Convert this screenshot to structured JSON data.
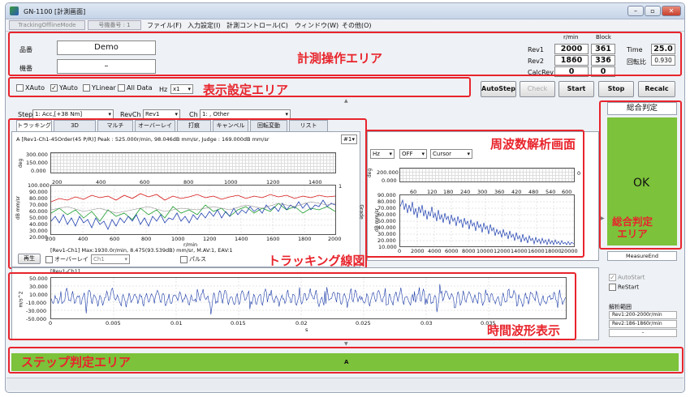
{
  "window": {
    "title": "GN-1100 [計測画面]"
  },
  "menubar": {
    "mode": "TrackingOfflineMode",
    "machine": "号機番号 : 1",
    "items": [
      "ファイル(F)",
      "入力設定(I)",
      "計測コントロール(C)",
      "ウィンドウ(W)",
      "その他(O)"
    ]
  },
  "measure": {
    "product_label": "品番",
    "product_value": "Demo",
    "model_label": "機番",
    "model_value": "–",
    "col_rpm": "r/min",
    "col_block": "Block",
    "rev1_label": "Rev1",
    "rev1_rpm": "2000",
    "rev1_block": "361",
    "rev2_label": "Rev2",
    "rev2_rpm": "1860",
    "rev2_block": "336",
    "calcrev_label": "CalcRev",
    "calcrev_rpm": "0",
    "calcrev_block": "0",
    "time_label": "Time",
    "time_value": "25.0",
    "ratio_label": "回転比",
    "ratio_value": "0.930"
  },
  "display": {
    "xauto": "XAuto",
    "yauto": "YAuto",
    "ylinear": "YLinear",
    "alldata": "All Data",
    "hz_label": "Hz",
    "hz_value": "x1"
  },
  "buttons": {
    "autostep": "AutoStep",
    "check": "Check",
    "start": "Start",
    "stop": "Stop",
    "recalc": "Recalc"
  },
  "selectors": {
    "step_label": "Step",
    "step_value": "1: Acc,[+38 Nm]",
    "revch_label": "RevCh",
    "revch_value": "Rev1",
    "ch_label": "Ch",
    "ch_value": "1: , Other"
  },
  "tabs": [
    "トラッキング",
    "3D",
    "マルチ",
    "オーバーレイ",
    "打痕",
    "キャンベル",
    "回転変動",
    "リスト"
  ],
  "tracking": {
    "header": "A [Rev1-Ch1-45Order(45 P/R)] Peak : 525.000r/min, 98.046dB mm/sr, Judge : 169.000dB mm/sr",
    "selector": "#1",
    "phase_ylabel": "deg",
    "phase_ticks": [
      "300.000",
      "150.000",
      "0.000"
    ],
    "amp_ylabel": "dB mm/sr",
    "amp_ticks": [
      "100.000",
      "90.000",
      "80.000",
      "70.000",
      "60.000",
      "50.000",
      "40.000",
      "30.000",
      "20.000"
    ],
    "top_x_ticks": [
      "200",
      "400",
      "600",
      "800",
      "1000",
      "1200",
      "1400"
    ],
    "bottom_x_ticks": [
      "200",
      "400",
      "600",
      "800",
      "1000",
      "1200",
      "1400",
      "1600",
      "1800",
      "2000"
    ],
    "xlabel": "r/min",
    "right_marker": "1",
    "info": "[Rev1-Ch1] Max:1930.0r/min, 8.475(93.539dB) mm/sr, M.AV:1, EAV:1",
    "play_button": "再生",
    "overlay_label": "オーバーレイ",
    "overlay_value": "Ch1",
    "pulse_label": "パルス"
  },
  "freq": {
    "dd1": "Hz",
    "dd2": "OFF",
    "dd3": "Cursor",
    "phase_ylabel": "deg",
    "phase_ticks": [
      "200.000",
      "0.000"
    ],
    "amp_ylabel": "dB mm/sr",
    "amp_side_label": "Grade",
    "amp_ticks": [
      "90.000",
      "80.000",
      "70.000",
      "60.000",
      "50.000",
      "40.000",
      "30.000",
      "20.000",
      "10.000"
    ],
    "top_x_ticks": [
      "60",
      "120",
      "180",
      "240",
      "300",
      "360",
      "420",
      "480",
      "540",
      "600"
    ],
    "bottom_x_ticks": [
      "0",
      "2000",
      "4000",
      "6000",
      "8000",
      "10000",
      "12000",
      "14000",
      "16000",
      "18000",
      "20000"
    ],
    "right_marker": "0"
  },
  "time_wave": {
    "label": "[Rev1-Ch1]",
    "ylabel": "m/s^2",
    "y_ticks": [
      "50.000",
      "30.000",
      "10.000",
      "-10.000",
      "-30.000",
      "-50.000"
    ],
    "x_ticks": [
      "0",
      "0.005",
      "0.01",
      "0.015",
      "0.02",
      "0.025",
      "0.03",
      "0.035"
    ],
    "xlabel": "s"
  },
  "judge": {
    "title": "総合判定",
    "result": "OK",
    "measure_end": "MeasureEnd",
    "autostart": "AutoStart",
    "restart": "ReStart",
    "range_title": "解析範囲",
    "range1": "Rev1:200-2000r/min",
    "range2": "Rev2:186-1860r/min",
    "range3": "–"
  },
  "step_bar": {
    "label": "A"
  },
  "annotations": {
    "measure": "計測操作エリア",
    "display": "表示設定エリア",
    "freq": "周波数解析画面",
    "tracking": "トラッキング線図",
    "time": "時間波形表示",
    "judge": "総合判定\nエリア",
    "step": "ステップ判定エリア"
  },
  "colors": {
    "ok_green": "#7cc23a",
    "annot_red": "#e8242c"
  }
}
